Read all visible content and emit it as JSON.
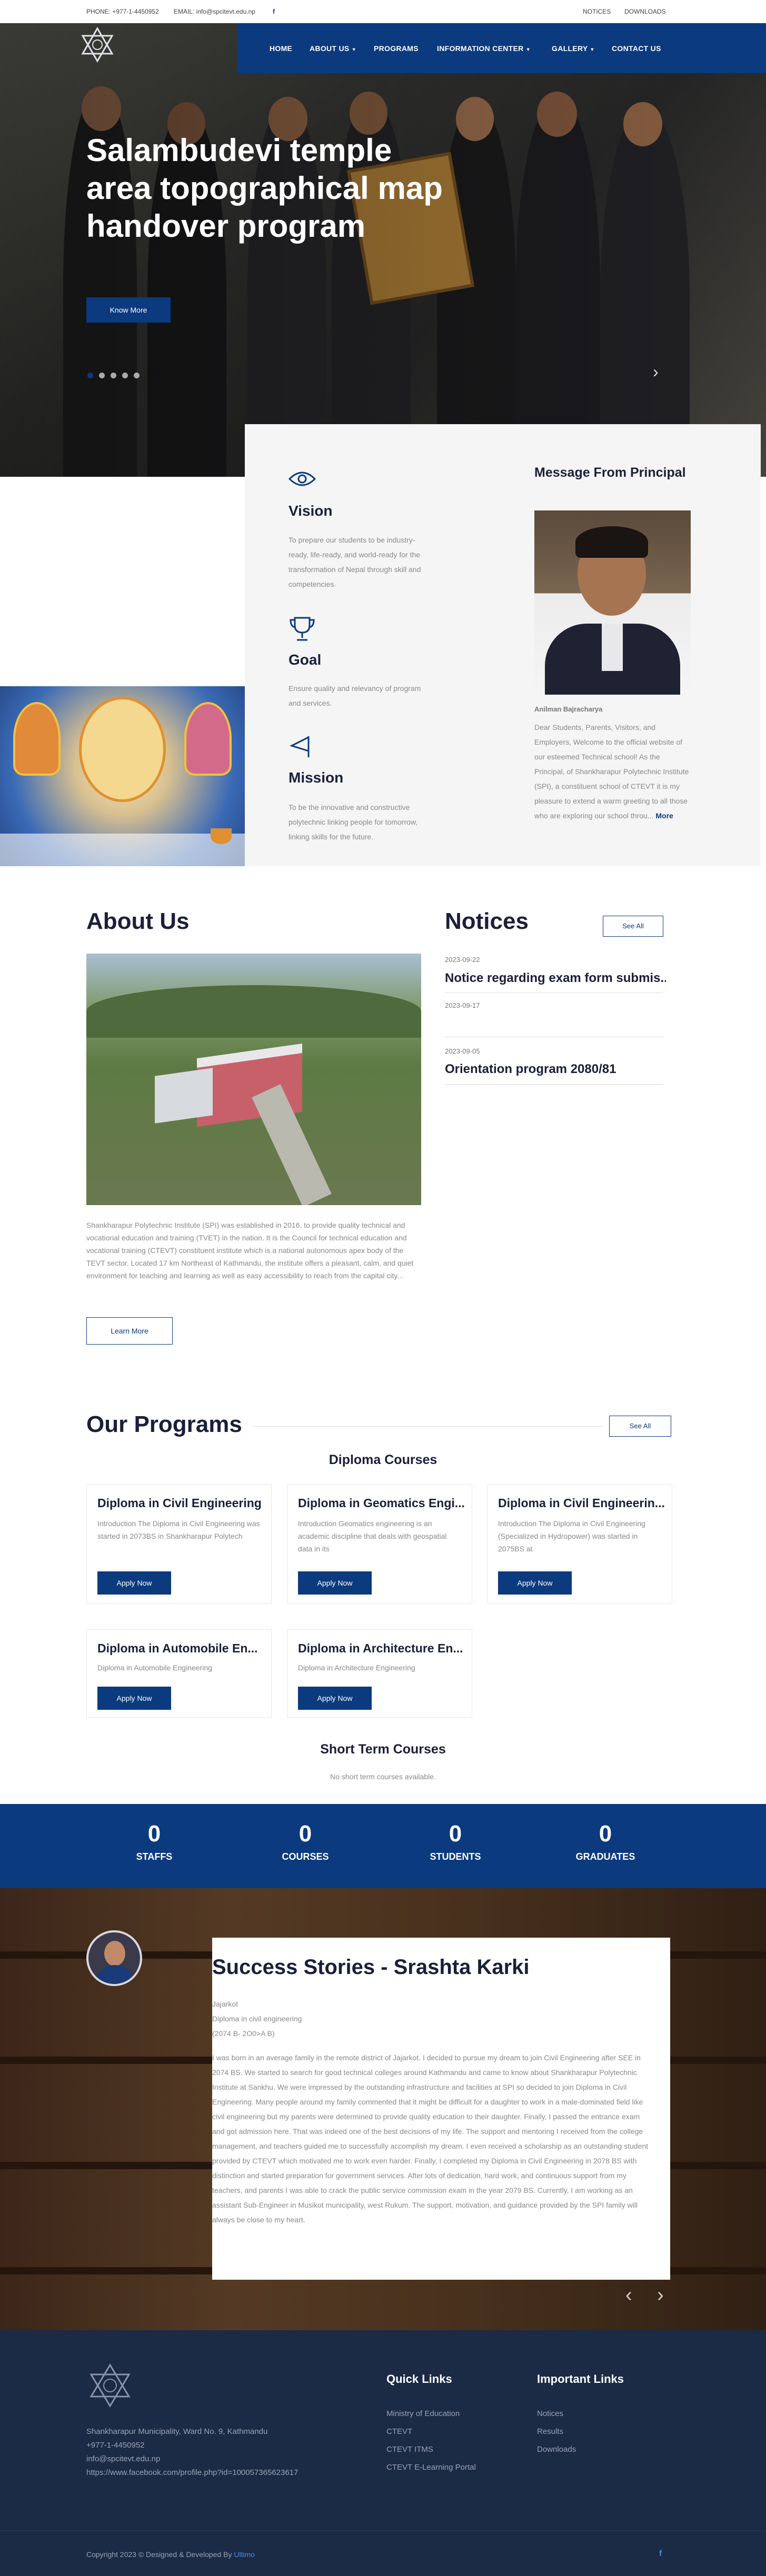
{
  "topbar": {
    "phone": "PHONE: +977-1-4450952",
    "email": "EMAIL: info@spcitevt.edu.np",
    "facebook_icon": "f",
    "notices": "NOTICES",
    "downloads": "DOWNLOADS"
  },
  "nav": {
    "home": "HOME",
    "about": "ABOUT US",
    "programs": "PROGRAMS",
    "info": "INFORMATION CENTER",
    "gallery": "GALLERY",
    "contact": "CONTACT US"
  },
  "hero": {
    "title": "Salambudevi temple area topographical map handover program",
    "button": "Know More"
  },
  "principal": {
    "heading": "Message From Principal",
    "name": "Anilman Bajracharya",
    "message": "Dear Students, Parents, Visitors, and Employers, Welcome to the official website of our esteemed Technical school! As the Principal, of Shankharapur Polytechnic Institute (SPI), a constituent school of CTEVT it is my pleasure to extend a warm greeting to all those who are exploring our school throu...",
    "more": "More"
  },
  "vmg": [
    {
      "title": "Vision",
      "text": "To prepare our students to be industry-ready, life-ready, and world-ready for the transformation of Nepal through skill and competencies."
    },
    {
      "title": "Goal",
      "text": "Ensure quality and relevancy of program and services."
    },
    {
      "title": "Mission",
      "text": "To be the innovative and constructive polytechnic linking people for tomorrow, linking skills for the future."
    }
  ],
  "about": {
    "title": "About Us",
    "text": "Shankharapur Polytechnic Institute (SPI) was established in 2016, to provide quality technical and vocational education and training (TVET) in the nation. It is the Council for technical education and vocational training (CTEVT) constituent institute which is a national autonomous apex body of the TEVT sector. Located 17 km Northeast of Kathmandu, the institute offers a pleasant, calm, and quiet environment for teaching and learning as well as easy accessibility to reach from the capital city...",
    "button": "Learn More"
  },
  "notices": {
    "title": "Notices",
    "see_all": "See All",
    "items": [
      {
        "date": "2023-09-22",
        "title": "Notice regarding exam form submis..."
      },
      {
        "date": "2023-09-17",
        "title": ""
      },
      {
        "date": "2023-09-05",
        "title": "Orientation program 2080/81"
      }
    ]
  },
  "programs": {
    "title": "Our Programs",
    "see_all": "See All",
    "diploma_heading": "Diploma Courses",
    "apply": "Apply Now",
    "items": [
      {
        "title": "Diploma in Civil Engineering",
        "text": "Introduction The Diploma in Civil Engineering was started in 2073BS in Shankharapur Polytech"
      },
      {
        "title": "Diploma in Geomatics Engi...",
        "text": "Introduction Geomatics engineering is an academic discipline that deals with geospatial data in its"
      },
      {
        "title": "Diploma in Civil Engineerin...",
        "text": "Introduction The Diploma in Civil Engineering (Specialized in Hydropower) was started in 2075BS at"
      },
      {
        "title": "Diploma in Automobile En...",
        "text": "Diploma in Automobile Engineering"
      },
      {
        "title": "Diploma in Architecture En...",
        "text": "Diploma in Architecture Engineering"
      }
    ],
    "short_heading": "Short Term Courses",
    "short_none": "No short term courses available."
  },
  "stats": [
    {
      "num": "0",
      "label": "STAFFS"
    },
    {
      "num": "0",
      "label": "COURSES"
    },
    {
      "num": "0",
      "label": "STUDENTS"
    },
    {
      "num": "0",
      "label": "GRADUATES"
    }
  ],
  "story": {
    "title": "Success Stories - Srashta Karki",
    "place": "Jajarkot",
    "program": "Diploma in civil engineering",
    "batch": "(2074 B- 2O0>A B)",
    "text": "I was born in an average family in the remote district of Jajarkot. I decided to pursue my dream to join Civil Engineering after SEE in 2074 BS. We started to search for good technical colleges around Kathmandu and came to know about Shankharapur Polytechnic Institute at Sankhu. We were impressed by the outstanding infrastructure and facilities at SPI so decided to join Diploma in Civil Engineering. Many people around my family commented that it might be difficult for a daughter to work in a male-dominated field like civil engineering but my parents were determined to provide quality education to their daughter. Finally, I passed the entrance exam and got admission here. That was indeed one of the best decisions of my life. The support and mentoring I received from the college management, and teachers guided me to successfully accomplish my dream. I even received a scholarship as an outstanding student provided by CTEVT which motivated me to work even harder. Finally, I completed my Diploma in Civil Engineering in 2078 BS with distinction and started preparation for government services. After lots of dedication, hard work, and continuous support from my teachers, and parents I was able to crack the public service commission exam in the year 2079 BS. Currently, I am working as an assistant Sub-Engineer in Musikot municipality, west Rukum. The support, motivation, and guidance provided by the SPI family will always be close to my heart."
  },
  "footer": {
    "address": "Shankharapur Municipality, Ward No. 9, Kathmandu",
    "phone": "+977-1-4450952",
    "email": "info@spcitevt.edu.np",
    "fb": "https://www.facebook.com/profile.php?id=100057365623617",
    "quick_title": "Quick Links",
    "quick": [
      "Ministry of Education",
      "CTEVT",
      "CTEVT ITMS",
      "CTEVT E-Learning Portal"
    ],
    "important_title": "Important Links",
    "important": [
      "Notices",
      "Results",
      "Downloads"
    ],
    "copyright": "Copyright 2023 © Designed & Developed By",
    "developer": "Ultimo",
    "fb_icon": "f"
  },
  "colors": {
    "primary": "#0b3a7e",
    "dark": "#1a1f3a",
    "footer": "#1b2a45"
  }
}
